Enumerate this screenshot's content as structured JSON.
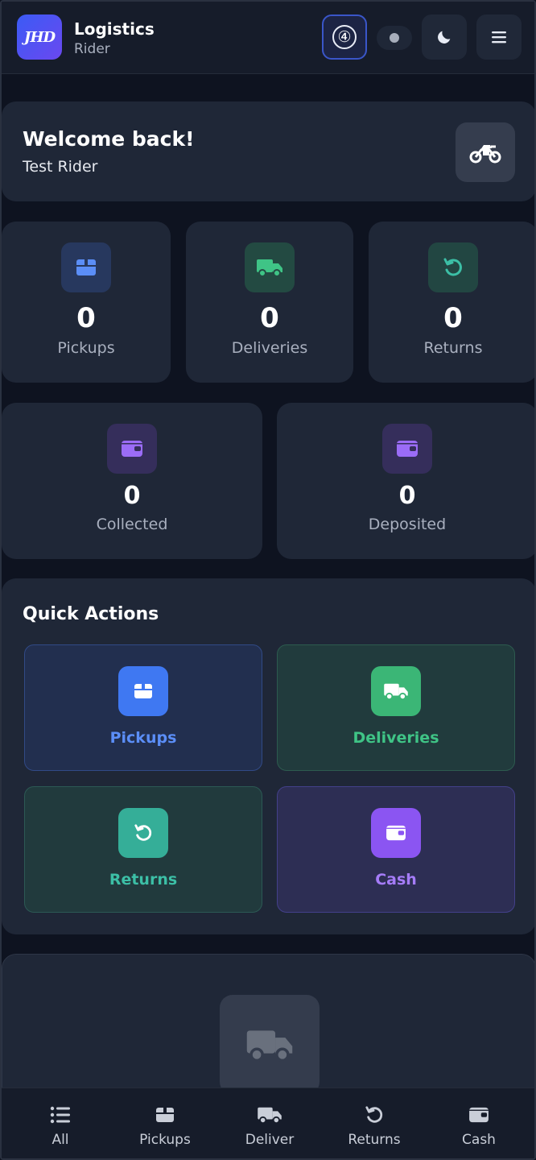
{
  "header": {
    "logo_text": "JHD",
    "title": "Logistics",
    "subtitle": "Rider",
    "badge_count": "④"
  },
  "welcome": {
    "heading": "Welcome back!",
    "name": "Test Rider"
  },
  "stats": [
    {
      "value": "0",
      "label": "Pickups"
    },
    {
      "value": "0",
      "label": "Deliveries"
    },
    {
      "value": "0",
      "label": "Returns"
    }
  ],
  "money": [
    {
      "value": "0",
      "label": "Collected"
    },
    {
      "value": "0",
      "label": "Deposited"
    }
  ],
  "quick_actions": {
    "title": "Quick Actions",
    "items": [
      {
        "label": "Pickups"
      },
      {
        "label": "Deliveries"
      },
      {
        "label": "Returns"
      },
      {
        "label": "Cash"
      }
    ]
  },
  "bottom_nav": [
    {
      "label": "All"
    },
    {
      "label": "Pickups"
    },
    {
      "label": "Deliver"
    },
    {
      "label": "Returns"
    },
    {
      "label": "Cash"
    }
  ],
  "colors": {
    "blue": "#4f86f7",
    "green": "#3fc486",
    "teal": "#3cbfa6",
    "purple": "#8c5cf6"
  }
}
